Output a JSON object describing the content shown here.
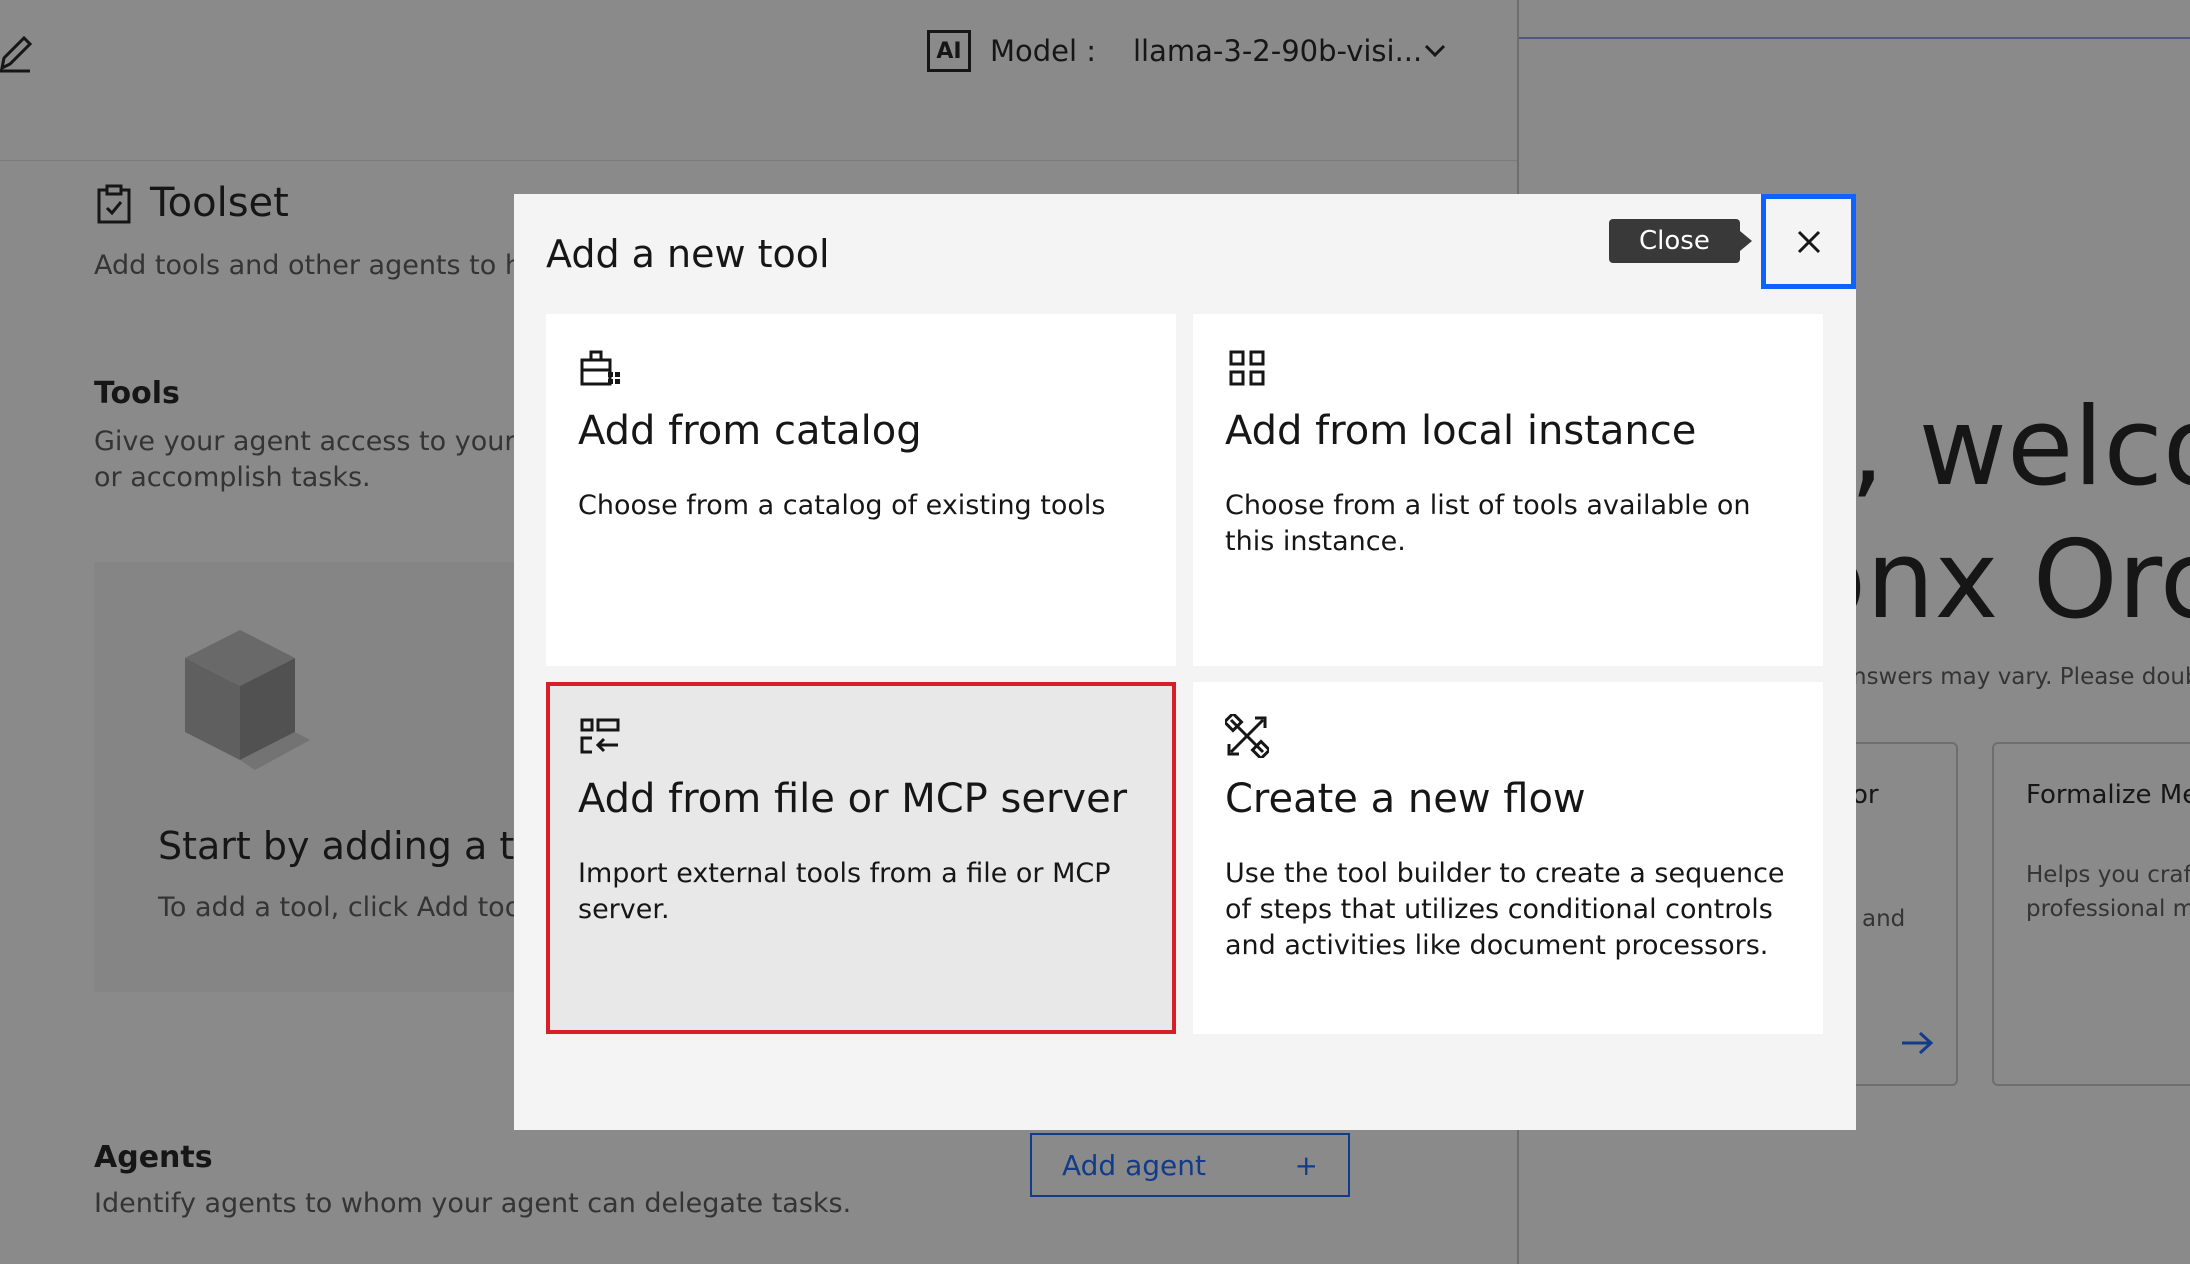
{
  "header": {
    "ai_badge": "AI",
    "model_label": "Model :",
    "model_value": "llama-3-2-90b-visi..."
  },
  "toolset": {
    "title": "Toolset",
    "description": "Add tools and other agents to he"
  },
  "tools": {
    "title": "Tools",
    "description": "Give your agent access to your or accomplish tasks.",
    "empty_title": "Start by adding a too",
    "empty_description": "To add a tool, click Add tool"
  },
  "agents": {
    "title": "Agents",
    "description": "Identify agents to whom your agent can delegate tasks.",
    "add_button": "Add agent",
    "add_icon": "+"
  },
  "welcome": {
    "line1": ", welcor",
    "line2": "onx Orc",
    "note": "nswers may vary. Please doub",
    "tile_a_title": "or",
    "tile_a_desc": "and",
    "tile_b_title": "Formalize Me",
    "tile_b_desc_1": "Helps you craft",
    "tile_b_desc_2": "professional m"
  },
  "modal": {
    "title": "Add a new tool",
    "close_tooltip": "Close",
    "cards": [
      {
        "icon": "toolbox-icon",
        "title": "Add from catalog",
        "description": "Choose from a catalog of existing tools"
      },
      {
        "icon": "grid-icon",
        "title": "Add from local instance",
        "description": "Choose from a list of tools available on this instance."
      },
      {
        "icon": "import-icon",
        "title": "Add from file or MCP server",
        "description": "Import external tools from a file or MCP server."
      },
      {
        "icon": "tools-crossed-icon",
        "title": "Create a new flow",
        "description": "Use the tool builder to create a sequence of steps that utilizes conditional controls and activities like document processors."
      }
    ]
  },
  "colors": {
    "accent": "#0f62fe",
    "highlight": "#da1e28",
    "overlay": "rgba(22,22,22,0.5)"
  }
}
